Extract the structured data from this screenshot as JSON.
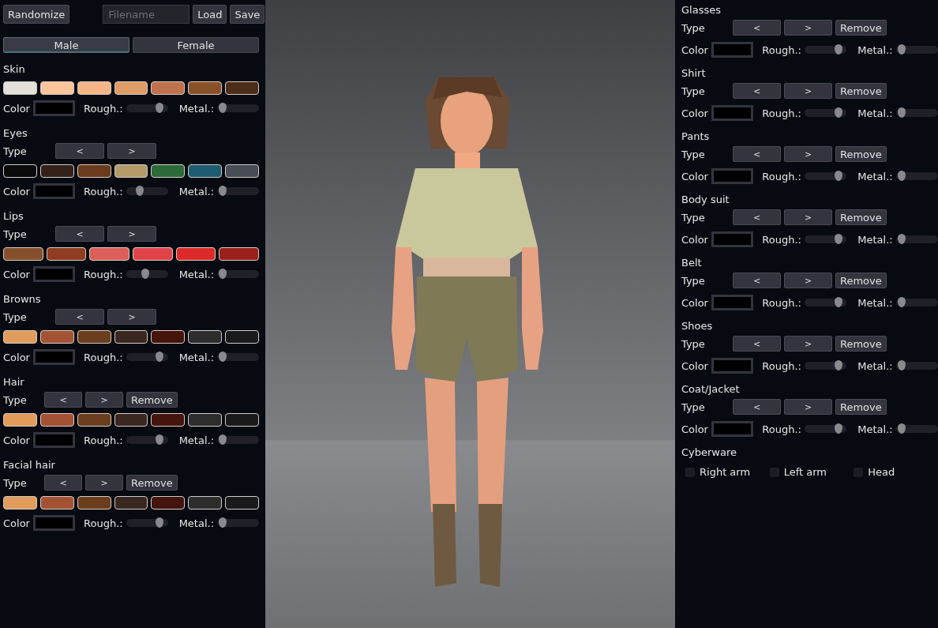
{
  "toolbar": {
    "randomize": "Randomize",
    "filename": {
      "placeholder": "Filename"
    },
    "load": "Load",
    "save": "Save"
  },
  "gender": [
    {
      "label": "Male",
      "selected": true
    },
    {
      "label": "Female",
      "selected": false
    }
  ],
  "left_sections": [
    {
      "title": "Skin",
      "swatches": [
        {
          "color": "#e4e0da"
        },
        {
          "color": "#fbc59c"
        },
        {
          "color": "#f7b585"
        },
        {
          "color": "#df9b65"
        },
        {
          "color": "#c0714e"
        },
        {
          "color": "#8a5129"
        },
        {
          "color": "#4c2d19"
        }
      ],
      "color_label": "Color",
      "rough_label": "Rough.:",
      "rough": {
        "level": 0.9
      },
      "metal_label": "Metal.:",
      "metal": {
        "level": 0.05
      }
    },
    {
      "title": "Eyes",
      "type": {
        "label": "Type",
        "prev": "<",
        "next": ">"
      },
      "swatches": [
        {
          "color": "#0b0b0b"
        },
        {
          "color": "#33211a"
        },
        {
          "color": "#6a3c1b"
        },
        {
          "color": "#b39b6a"
        },
        {
          "color": "#2d6a39"
        },
        {
          "color": "#1e5d71"
        },
        {
          "color": "#474c55"
        }
      ],
      "color_label": "Color",
      "rough_label": "Rough.:",
      "rough": {
        "level": 0.3
      },
      "metal_label": "Metal.:",
      "metal": {
        "level": 0.05
      }
    },
    {
      "title": "Lips",
      "type": {
        "label": "Type",
        "prev": "<",
        "next": ">"
      },
      "swatches": [
        {
          "color": "#86502c"
        },
        {
          "color": "#8f3d21"
        },
        {
          "color": "#dd5f59"
        },
        {
          "color": "#e0444a"
        },
        {
          "color": "#dc2a2a"
        },
        {
          "color": "#9a211b"
        }
      ],
      "color_label": "Color",
      "rough_label": "Rough.:",
      "rough": {
        "level": 0.45
      },
      "metal_label": "Metal.:",
      "metal": {
        "level": 0.05
      }
    },
    {
      "title": "Browns",
      "type": {
        "label": "Type",
        "prev": "<",
        "next": ">"
      },
      "swatches": [
        {
          "color": "#e19c5b"
        },
        {
          "color": "#a55234"
        },
        {
          "color": "#6b3e1d"
        },
        {
          "color": "#3a2820"
        },
        {
          "color": "#45140c"
        },
        {
          "color": "#2d2d2d"
        },
        {
          "color": "#1a1a1a"
        }
      ],
      "color_label": "Color",
      "rough_label": "Rough.:",
      "rough": {
        "level": 0.9
      },
      "metal_label": "Metal.:",
      "metal": {
        "level": 0.05
      }
    },
    {
      "title": "Hair",
      "type": {
        "label": "Type",
        "prev": "<",
        "next": ">",
        "remove": "Remove"
      },
      "swatches": [
        {
          "color": "#e19c5b"
        },
        {
          "color": "#a55234"
        },
        {
          "color": "#6b3e1d"
        },
        {
          "color": "#3a2820"
        },
        {
          "color": "#45140c"
        },
        {
          "color": "#2d2d2d"
        },
        {
          "color": "#1a1a1a"
        }
      ],
      "color_label": "Color",
      "rough_label": "Rough.:",
      "rough": {
        "level": 0.9
      },
      "metal_label": "Metal.:",
      "metal": {
        "level": 0.05
      }
    },
    {
      "title": "Facial hair",
      "type": {
        "label": "Type",
        "prev": "<",
        "next": ">",
        "remove": "Remove"
      },
      "swatches": [
        {
          "color": "#e19c5b"
        },
        {
          "color": "#a55234"
        },
        {
          "color": "#6b3e1d"
        },
        {
          "color": "#3a2820"
        },
        {
          "color": "#45140c"
        },
        {
          "color": "#2d2d2d"
        },
        {
          "color": "#1a1a1a"
        }
      ],
      "color_label": "Color",
      "rough_label": "Rough.:",
      "rough": {
        "level": 0.9
      },
      "metal_label": "Metal.:",
      "metal": {
        "level": 0.05
      }
    }
  ],
  "right_sections": [
    {
      "title": "Glasses",
      "type": {
        "label": "Type",
        "prev": "<",
        "next": ">",
        "remove": "Remove"
      },
      "color_label": "Color",
      "rough_label": "Rough.:",
      "rough": {
        "level": 0.9
      },
      "metal_label": "Metal.:",
      "metal": {
        "level": 0.05
      }
    },
    {
      "title": "Shirt",
      "type": {
        "label": "Type",
        "prev": "<",
        "next": ">",
        "remove": "Remove"
      },
      "color_label": "Color",
      "rough_label": "Rough.:",
      "rough": {
        "level": 0.9
      },
      "metal_label": "Metal.:",
      "metal": {
        "level": 0.05
      }
    },
    {
      "title": "Pants",
      "type": {
        "label": "Type",
        "prev": "<",
        "next": ">",
        "remove": "Remove"
      },
      "color_label": "Color",
      "rough_label": "Rough.:",
      "rough": {
        "level": 0.9
      },
      "metal_label": "Metal.:",
      "metal": {
        "level": 0.05
      }
    },
    {
      "title": "Body suit",
      "type": {
        "label": "Type",
        "prev": "<",
        "next": ">",
        "remove": "Remove"
      },
      "color_label": "Color",
      "rough_label": "Rough.:",
      "rough": {
        "level": 0.9
      },
      "metal_label": "Metal.:",
      "metal": {
        "level": 0.05
      }
    },
    {
      "title": "Belt",
      "type": {
        "label": "Type",
        "prev": "<",
        "next": ">",
        "remove": "Remove"
      },
      "color_label": "Color",
      "rough_label": "Rough.:",
      "rough": {
        "level": 0.9
      },
      "metal_label": "Metal.:",
      "metal": {
        "level": 0.05
      }
    },
    {
      "title": "Shoes",
      "type": {
        "label": "Type",
        "prev": "<",
        "next": ">",
        "remove": "Remove"
      },
      "color_label": "Color",
      "rough_label": "Rough.:",
      "rough": {
        "level": 0.9
      },
      "metal_label": "Metal.:",
      "metal": {
        "level": 0.05
      }
    },
    {
      "title": "Coat/Jacket",
      "type": {
        "label": "Type",
        "prev": "<",
        "next": ">",
        "remove": "Remove"
      },
      "color_label": "Color",
      "rough_label": "Rough.:",
      "rough": {
        "level": 0.9
      },
      "metal_label": "Metal.:",
      "metal": {
        "level": 0.05
      }
    }
  ],
  "cyberware": {
    "title": "Cyberware",
    "options": [
      {
        "label": "Right arm",
        "checked": false
      },
      {
        "label": "Left arm",
        "checked": false
      },
      {
        "label": "Head",
        "checked": false
      }
    ]
  }
}
